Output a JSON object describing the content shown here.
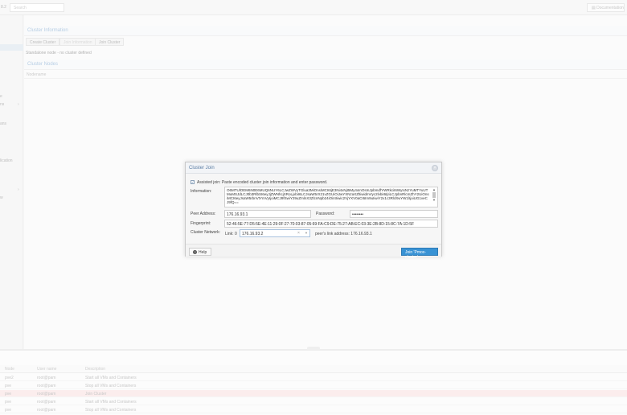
{
  "topbar": {
    "version_fragment": "8.2",
    "search_placeholder": "Search",
    "documentation_label": "Documentation"
  },
  "sidebar_fragments": [
    "e",
    "ns",
    "ans",
    "lication",
    "w"
  ],
  "main": {
    "cluster_information_title": "Cluster Information",
    "toolbar": {
      "create_cluster": "Create Cluster",
      "join_information": "Join Information",
      "join_cluster": "Join Cluster"
    },
    "standalone_text": "Standalone node - no cluster defined",
    "cluster_nodes_title": "Cluster Nodes",
    "nodename_header": "Nodename"
  },
  "dialog": {
    "title": "Cluster Join",
    "assisted_join_label": "Assisted join: Paste encoded cluster join information and enter password.",
    "assisted_join_checked": true,
    "information_label": "Information:",
    "information_value": "O6MTUlOEM6N0E6MUQ6NUY6LCJwZWVyTGlua3MiOnsiMCI6IjE3Ni4xNjI5My4xInOsInJpbmdfYWRkciI6WyIxNzYuMTYuUTMuMSJdLCJ0b3RlbSI6eyJjZWNhcjXRoLjxbiI6LCJsaW5rX21vZGUiOiJwYXNzaXZlIiwidmVyc2lvbiI6IjIiLCJpbnRlcmZhY2UiOnsiMCI6eyJsaW5rbnVtYmVyIjoiMCJ9fSwiY29uZmlnX3ZlcnNpb24iOiI4Iiwic2VjYXV0aCI6Im9uIiwiY2x1c3Rlcl9uYW1lIjoiUG1veCJ9fQ==",
    "peer_address_label": "Peer Address:",
    "peer_address_value": "176.16.93.1",
    "password_label": "Password:",
    "password_value": "••••••••",
    "fingerprint_label": "Fingerprint:",
    "fingerprint_value": "52:46:5E:77:D5:5E:4E:11:29:0F:27:70:03:87:05:69:FA:C9:DE:75:27:AB:EC:03:3E:2B:8D:15:8C:7A:1D:5F",
    "cluster_network_label": "Cluster Network:",
    "link_label": "Link: 0",
    "link_value": "176.16.93.2",
    "peer_link_text": "peer's link address: 176.16.93.1",
    "help_label": "Help",
    "join_button_label": "Join 'Pmox-cluster'"
  },
  "log": {
    "headers": [
      "Node",
      "User name",
      "Description"
    ],
    "rows": [
      {
        "node": "pve2",
        "user": "root@pam",
        "desc": "Start all VMs and Containers",
        "error": false
      },
      {
        "node": "pve",
        "user": "root@pam",
        "desc": "Stop all VMs and Containers",
        "error": false
      },
      {
        "node": "pve",
        "user": "root@pam",
        "desc": "Join Cluster",
        "error": true
      },
      {
        "node": "pve",
        "user": "root@pam",
        "desc": "Start all VMs and Containers",
        "error": false
      },
      {
        "node": "pve",
        "user": "root@pam",
        "desc": "Stop all VMs and Containers",
        "error": false
      }
    ]
  },
  "colors": {
    "accent_blue": "#3892d4",
    "title_blue": "#5b7da4",
    "error_row": "#f9e3e3"
  }
}
